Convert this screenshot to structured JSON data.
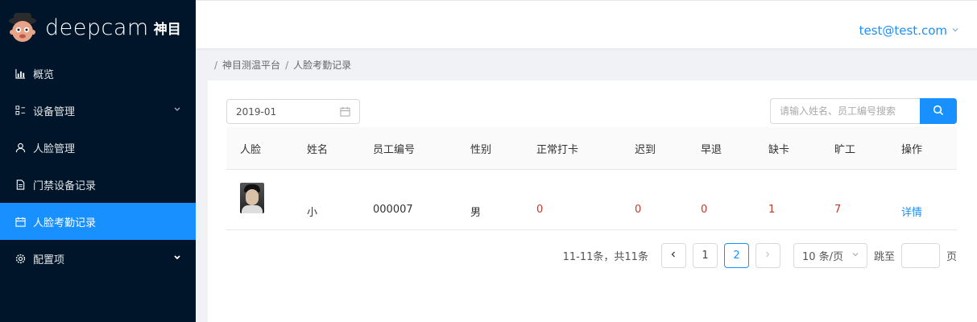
{
  "brand": {
    "name": "deepcam",
    "cn_name": "神目"
  },
  "sidebar": {
    "items": [
      {
        "label": "概览",
        "icon": "chart-icon"
      },
      {
        "label": "设备管理",
        "icon": "device-icon",
        "expandable": true
      },
      {
        "label": "人脸管理",
        "icon": "user-icon"
      },
      {
        "label": "门禁设备记录",
        "icon": "file-icon"
      },
      {
        "label": "人脸考勤记录",
        "icon": "calendar-icon",
        "active": true
      },
      {
        "label": "配置项",
        "icon": "gear-icon",
        "expandable": true
      }
    ]
  },
  "header": {
    "user": "test@test.com"
  },
  "breadcrumb": {
    "items": [
      "神目测温平台",
      "人脸考勤记录"
    ]
  },
  "filters": {
    "date": "2019-01",
    "search_placeholder": "请输入姓名、员工编号搜索"
  },
  "table": {
    "columns": [
      "人脸",
      "姓名",
      "员工编号",
      "性别",
      "正常打卡",
      "迟到",
      "早退",
      "缺卡",
      "旷工",
      "操作"
    ],
    "rows": [
      {
        "name": "小",
        "employee_id": "000007",
        "gender": "男",
        "normal": "0",
        "late": "0",
        "early": "0",
        "missing": "1",
        "absent": "7",
        "action": "详情"
      }
    ]
  },
  "pagination": {
    "total_text": "11-11条，共11条",
    "pages": [
      "1",
      "2"
    ],
    "current": "2",
    "page_size": "10 条/页",
    "jump_label": "跳至",
    "jump_suffix": "页"
  },
  "colors": {
    "accent": "#1890ff",
    "sidebar_bg": "#001529",
    "danger": "#c0392b"
  }
}
